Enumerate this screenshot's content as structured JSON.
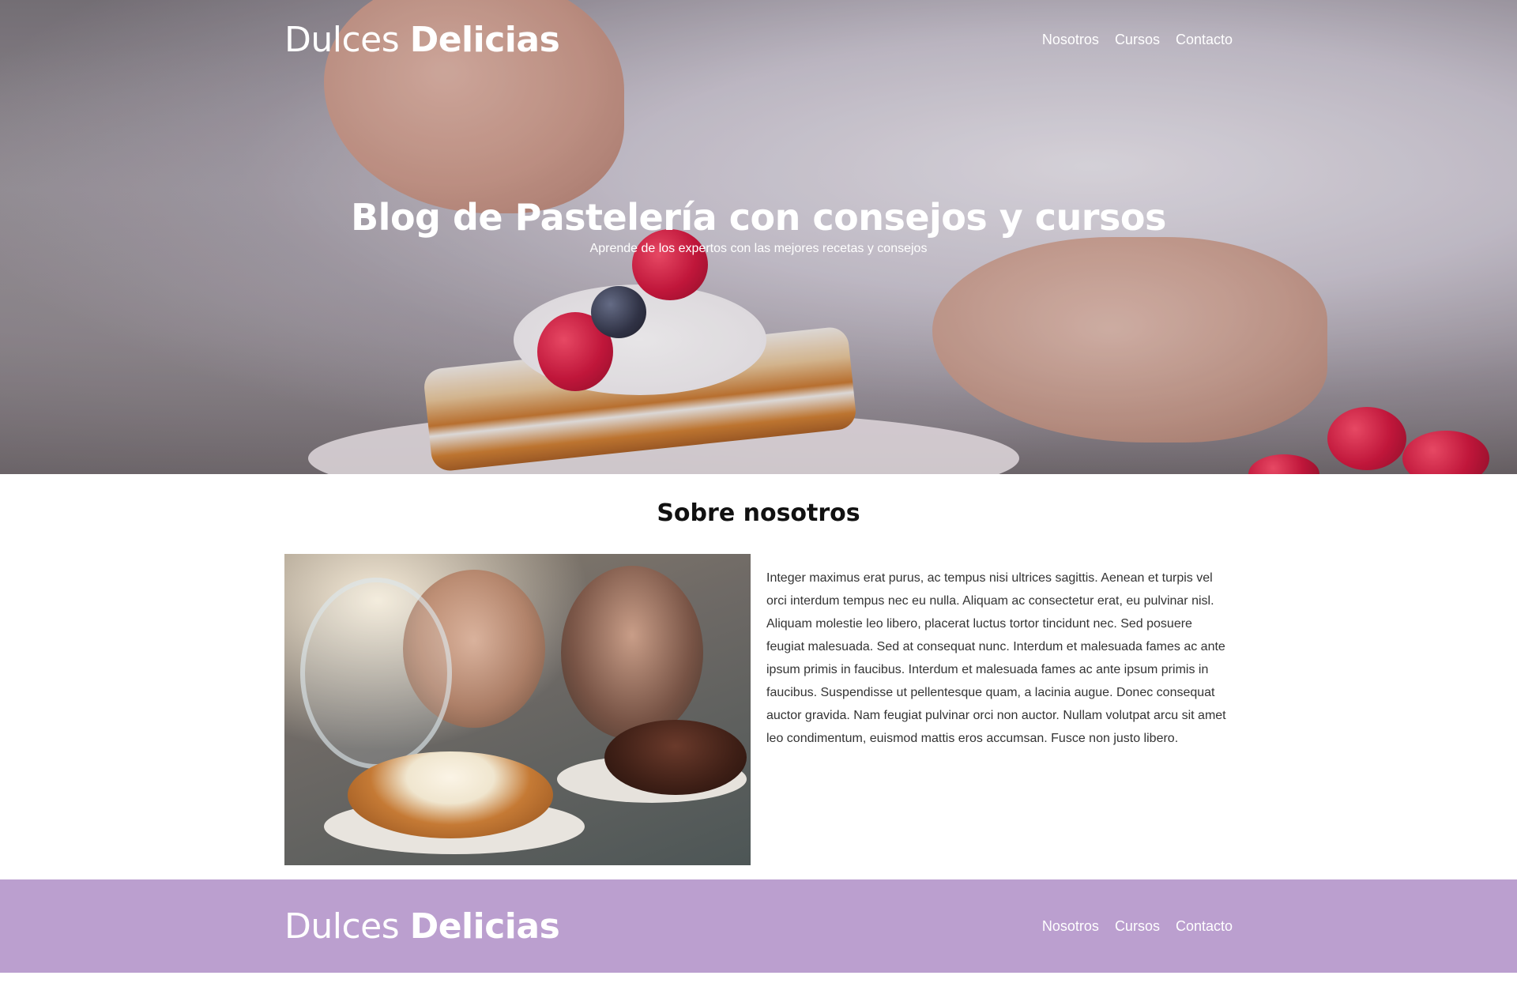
{
  "brand": {
    "name_light": "Dulces",
    "name_bold": "Delicias"
  },
  "nav": {
    "items": [
      {
        "label": "Nosotros"
      },
      {
        "label": "Cursos"
      },
      {
        "label": "Contacto"
      }
    ]
  },
  "hero": {
    "title": "Blog de Pastelería con consejos y cursos",
    "subtitle": "Aprende de los expertos con las mejores recetas y consejos"
  },
  "about": {
    "title": "Sobre nosotros",
    "body": "Integer maximus erat purus, ac tempus nisi ultrices sagittis. Aenean et turpis vel orci interdum tempus nec eu nulla. Aliquam ac consectetur erat, eu pulvinar nisl. Aliquam molestie leo libero, placerat luctus tortor tincidunt nec. Sed posuere feugiat malesuada. Sed at consequat nunc. Interdum et malesuada fames ac ante ipsum primis in faucibus. Interdum et malesuada fames ac ante ipsum primis in faucibus. Suspendisse ut pellentesque quam, a lacinia augue. Donec consequat auctor gravida. Nam feugiat pulvinar orci non auctor. Nullam volutpat arcu sit amet leo condimentum, euismod mattis eros accumsan. Fusce non justo libero."
  },
  "footer": {
    "name_light": "Dulces",
    "name_bold": "Delicias",
    "nav": [
      {
        "label": "Nosotros"
      },
      {
        "label": "Cursos"
      },
      {
        "label": "Contacto"
      }
    ]
  },
  "colors": {
    "footer_bg": "#bb9fcf",
    "hero_text": "#ffffff"
  }
}
